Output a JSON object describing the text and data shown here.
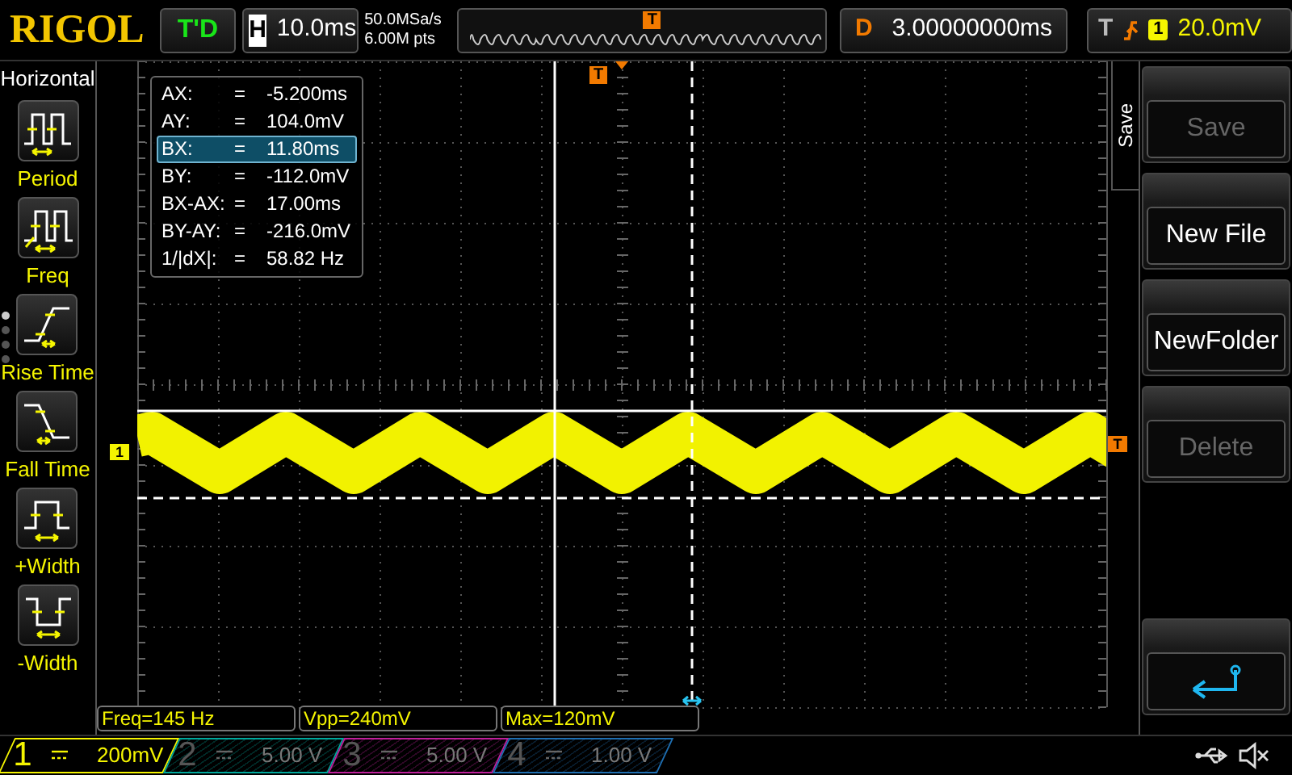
{
  "brand": "RIGOL",
  "run_status": "T'D",
  "timebase": {
    "label": "H",
    "value": "10.0ms"
  },
  "sample_rate": "50.0MSa/s",
  "memory_depth": "6.00M pts",
  "overview_marker": "T",
  "delay": {
    "label": "D",
    "value": "3.00000000ms"
  },
  "trigger": {
    "label": "T",
    "source": "1",
    "level": "20.0mV"
  },
  "left_menu": {
    "title": "Horizontal",
    "items": [
      {
        "label": "Period",
        "kind": "period"
      },
      {
        "label": "Freq",
        "kind": "freq"
      },
      {
        "label": "Rise Time",
        "kind": "rise"
      },
      {
        "label": "Fall Time",
        "kind": "fall"
      },
      {
        "label": "+Width",
        "kind": "pwidth"
      },
      {
        "label": "-Width",
        "kind": "nwidth"
      }
    ],
    "pages": [
      {
        "selected": true
      },
      {
        "selected": false
      },
      {
        "selected": false
      },
      {
        "selected": false
      }
    ]
  },
  "cursor_readout": [
    {
      "label": "AX:",
      "sign": "=",
      "value": "-5.200ms",
      "selected": false
    },
    {
      "label": "AY:",
      "sign": "=",
      "value": "104.0mV",
      "selected": false
    },
    {
      "label": "BX:",
      "sign": "=",
      "value": "11.80ms",
      "selected": true
    },
    {
      "label": "BY:",
      "sign": "=",
      "value": "-112.0mV",
      "selected": false
    },
    {
      "label": "BX-AX:",
      "sign": "=",
      "value": "17.00ms",
      "selected": false
    },
    {
      "label": "BY-AY:",
      "sign": "=",
      "value": "-216.0mV",
      "selected": false
    },
    {
      "label": "1/|dX|:",
      "sign": "=",
      "value": "58.82 Hz",
      "selected": false
    }
  ],
  "trigger_position_marker": "T",
  "channel_marker": "1",
  "trigger_level_marker": "T",
  "measurements": [
    "Freq=145 Hz",
    "Vpp=240mV",
    "Max=120mV"
  ],
  "channels": [
    {
      "number": "1",
      "scale": "200mV",
      "selected": true,
      "color": "#f5f500"
    },
    {
      "number": "2",
      "scale": "5.00 V",
      "selected": false,
      "color": "#00a99d"
    },
    {
      "number": "3",
      "scale": "5.00 V",
      "selected": false,
      "color": "#c0209c"
    },
    {
      "number": "4",
      "scale": "1.00 V",
      "selected": false,
      "color": "#1f6fb2"
    }
  ],
  "right_menu": {
    "title": "Save",
    "buttons": [
      {
        "kind": "text",
        "label": "Save",
        "disabled": true
      },
      {
        "kind": "text",
        "label": "New File",
        "disabled": false
      },
      {
        "kind": "text",
        "label": "NewFolder",
        "disabled": false
      },
      {
        "kind": "text",
        "label": "Delete",
        "disabled": true
      },
      {
        "kind": "gap"
      },
      {
        "kind": "back"
      }
    ]
  }
}
